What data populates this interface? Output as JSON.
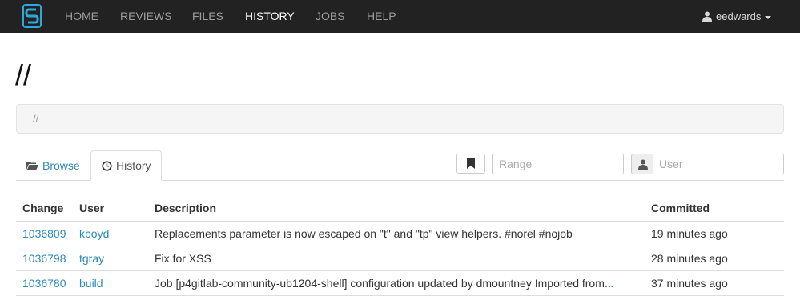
{
  "colors": {
    "navbar_bg": "#222222",
    "link": "#2a8ab8",
    "nav_active": "#ffffff",
    "nav_inactive": "#9d9d9d",
    "logo": "#2ea8d9"
  },
  "nav": {
    "items": [
      {
        "label": "HOME",
        "icon": null
      },
      {
        "label": "REVIEWS"
      },
      {
        "label": "FILES"
      },
      {
        "label": "HISTORY",
        "active": true
      },
      {
        "label": "JOBS"
      },
      {
        "label": "HELP"
      }
    ],
    "user": "eedwards",
    "logo_icon": "swarm-logo-icon"
  },
  "page": {
    "title": "//",
    "breadcrumb": "//"
  },
  "tabs": [
    {
      "label": "Browse",
      "icon": "folder-open-icon"
    },
    {
      "label": "History",
      "icon": "clock-icon",
      "active": true
    }
  ],
  "filters": {
    "bookmark_icon": "bookmark-icon",
    "range_placeholder": "Range",
    "user_icon": "user-icon",
    "user_placeholder": "User"
  },
  "table": {
    "columns": [
      "Change",
      "User",
      "Description",
      "Committed"
    ],
    "rows": [
      {
        "change": "1036809",
        "user": "kboyd",
        "description": "Replacements parameter is now escaped on \"t\" and \"tp\" view helpers. #norel #nojob",
        "more": "",
        "committed": "19 minutes ago"
      },
      {
        "change": "1036798",
        "user": "tgray",
        "description": "Fix for XSS",
        "more": "",
        "committed": "28 minutes ago"
      },
      {
        "change": "1036780",
        "user": "build",
        "description": "Job [p4gitlab-community-ub1204-shell] configuration updated by dmountney Imported from",
        "more": "...",
        "committed": "37 minutes ago"
      }
    ]
  }
}
